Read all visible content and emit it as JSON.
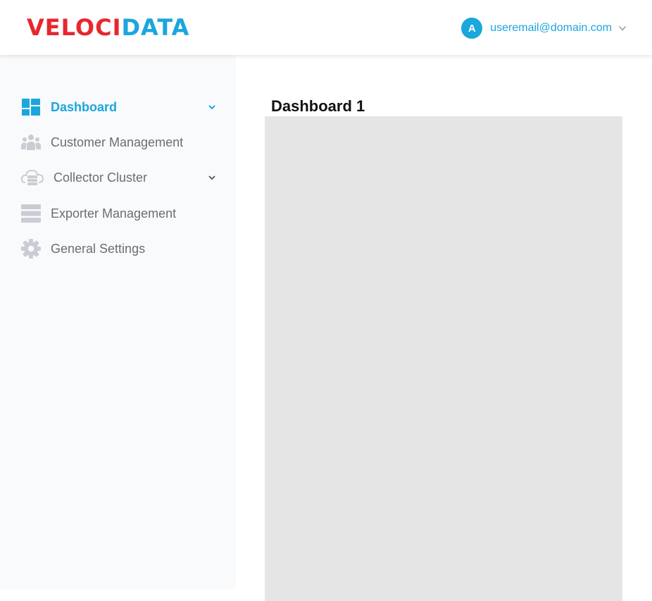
{
  "brand": {
    "logo_part1": "VELOCI",
    "logo_part2": "DATA"
  },
  "user": {
    "avatar_letter": "A",
    "email": "useremail@domain.com"
  },
  "sidebar": {
    "items": [
      {
        "label": "Dashboard",
        "icon": "dashboard-icon",
        "active": true,
        "has_chevron": true
      },
      {
        "label": "Customer Management",
        "icon": "users-icon",
        "active": false,
        "has_chevron": false
      },
      {
        "label": "Collector Cluster",
        "icon": "cloud-server-icon",
        "active": false,
        "has_chevron": true
      },
      {
        "label": "Exporter Management",
        "icon": "server-stack-icon",
        "active": false,
        "has_chevron": false
      },
      {
        "label": "General Settings",
        "icon": "gear-icon",
        "active": false,
        "has_chevron": false
      }
    ]
  },
  "main": {
    "title": "Dashboard 1"
  },
  "colors": {
    "accent": "#1ba6dc",
    "brand_red": "#e8262e",
    "sidebar_bg": "#f9fafc",
    "panel_bg": "#e5e5e5",
    "icon_gray": "#c9cdd3"
  }
}
